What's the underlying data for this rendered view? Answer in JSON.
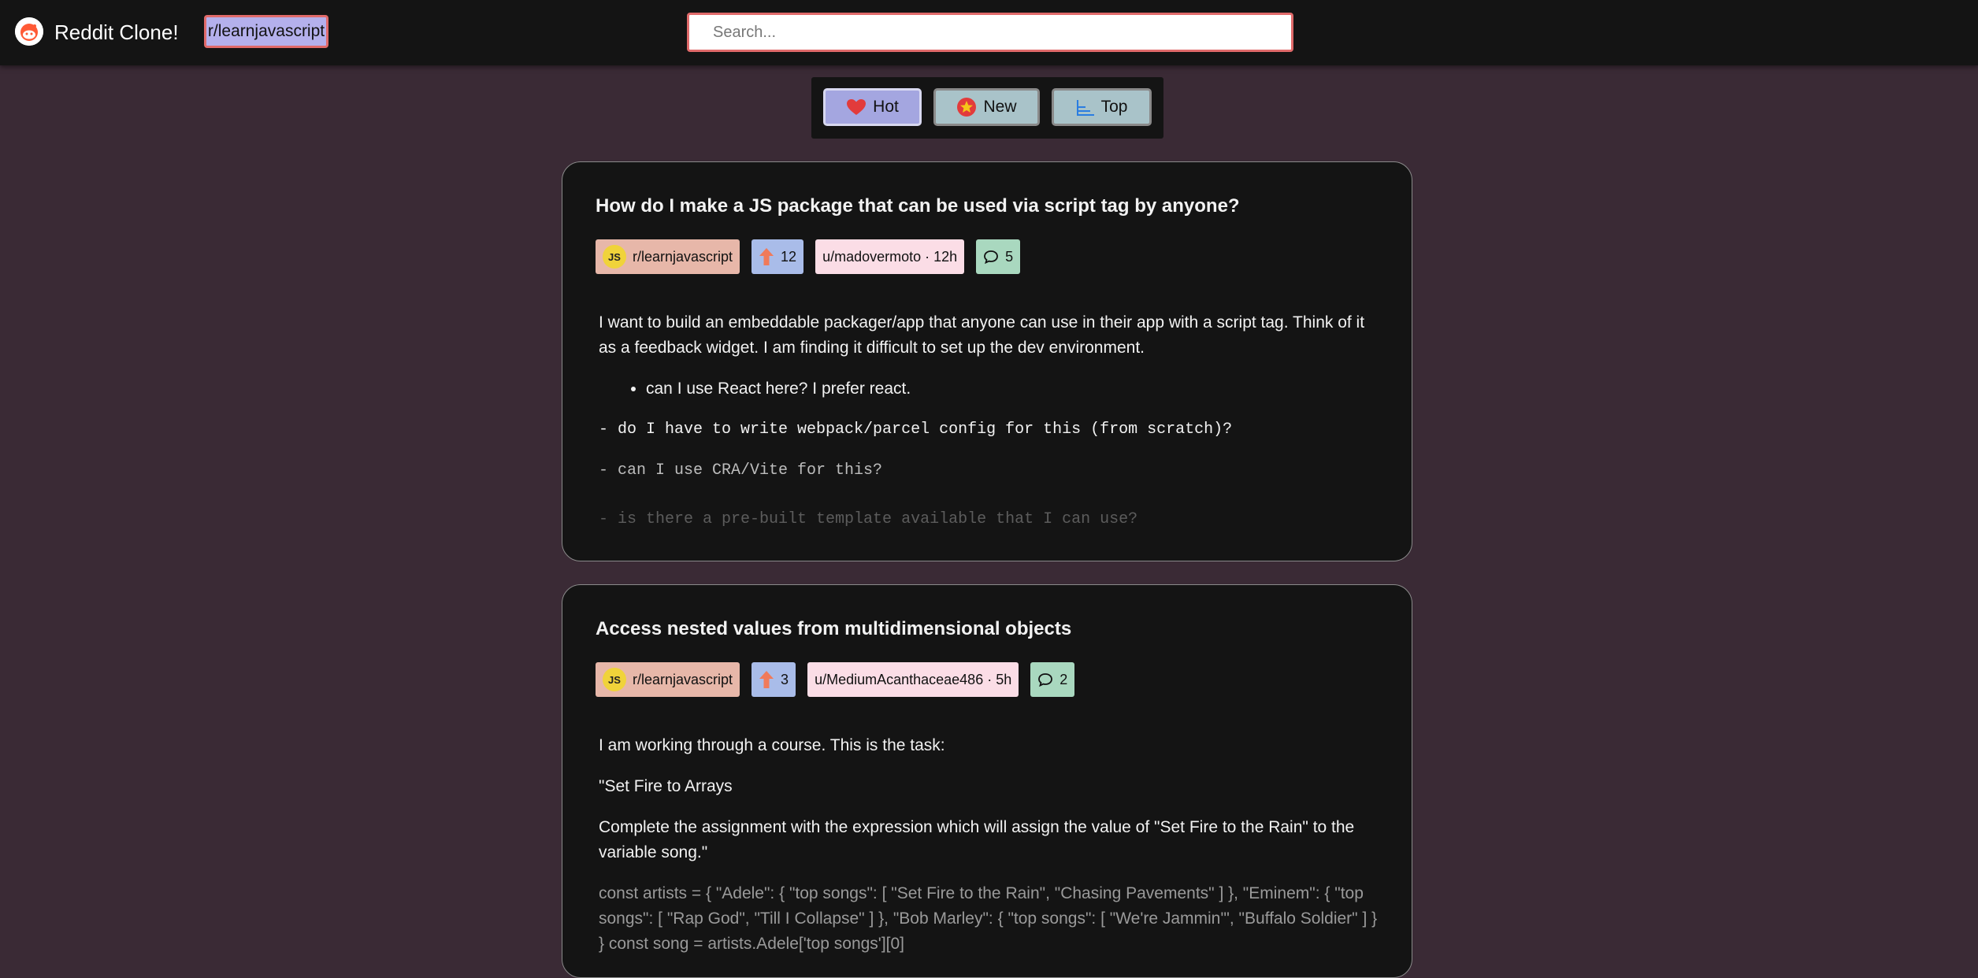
{
  "header": {
    "app_title": "Reddit Clone!",
    "subreddit_button": "r/learnjavascript",
    "search_placeholder": "Search..."
  },
  "sort": {
    "hot": "Hot",
    "new": "New",
    "top": "Top",
    "active": "Hot"
  },
  "posts": [
    {
      "title": "How do I make a JS package that can be used via script tag by anyone?",
      "subreddit": "r/learnjavascript",
      "upvotes": "12",
      "author": "u/madovermoto · 12h",
      "comments": "5",
      "body": {
        "p1": "I want to build an embeddable packager/app that anyone can use in their app with a script tag. Think of it as a feedback widget. I am finding it difficult to set up the dev environment.",
        "bullet1": "can I use React here? I prefer react.",
        "code1": "- do I have to write webpack/parcel config for this (from scratch)?",
        "code2": "- can I use CRA/Vite for this?",
        "code3": "- is there a pre-built template available that I can use?"
      }
    },
    {
      "title": "Access nested values from multidimensional objects",
      "subreddit": "r/learnjavascript",
      "upvotes": "3",
      "author": "u/MediumAcanthaceae486 · 5h",
      "comments": "2",
      "body": {
        "p1": "I am working through a course. This is the task:",
        "p2": "\"Set Fire to Arrays",
        "p3": "Complete the assignment with the expression which will assign the value of \"Set Fire to the Rain\" to the variable song.\"",
        "p4": "const artists = { \"Adele\": { \"top songs\": [ \"Set Fire to the Rain\", \"Chasing Pavements\" ] }, \"Eminem\": { \"top songs\": [ \"Rap God\", \"Till I Collapse\" ] }, \"Bob Marley\": { \"top songs\": [ \"We're Jammin'\", \"Buffalo Soldier\" ] } } const song = artists.Adele['top songs'][0]"
      }
    }
  ],
  "colors": {
    "page_bg": "#3a2a35",
    "header_bg": "#141414",
    "accent_border": "#e06a6a",
    "subreddit_chip": "#e7b7a9",
    "upvote_chip": "#a9bce9",
    "author_chip": "#fbdde6",
    "comment_chip": "#a9d8bf"
  },
  "icons": {
    "logo": "reddit-alien-icon",
    "hot": "heart-icon",
    "new": "star-badge-icon",
    "top": "bar-chart-icon",
    "subreddit": "js-badge-icon",
    "upvote": "up-arrow-icon",
    "comments": "speech-bubble-icon"
  }
}
